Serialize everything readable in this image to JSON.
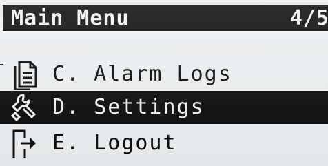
{
  "header": {
    "title": "Main Menu",
    "page_indicator": "4/5"
  },
  "menu": {
    "items": [
      {
        "label": "C. Alarm Logs",
        "icon": "document-icon",
        "selected": false
      },
      {
        "label": "D. Settings",
        "icon": "wrench-icon",
        "selected": true
      },
      {
        "label": "E. Logout",
        "icon": "logout-door-icon",
        "selected": false
      }
    ]
  },
  "colors": {
    "background": "#eceff1",
    "foreground": "#0a0a0a",
    "inverse_text": "#f2f2f2"
  }
}
